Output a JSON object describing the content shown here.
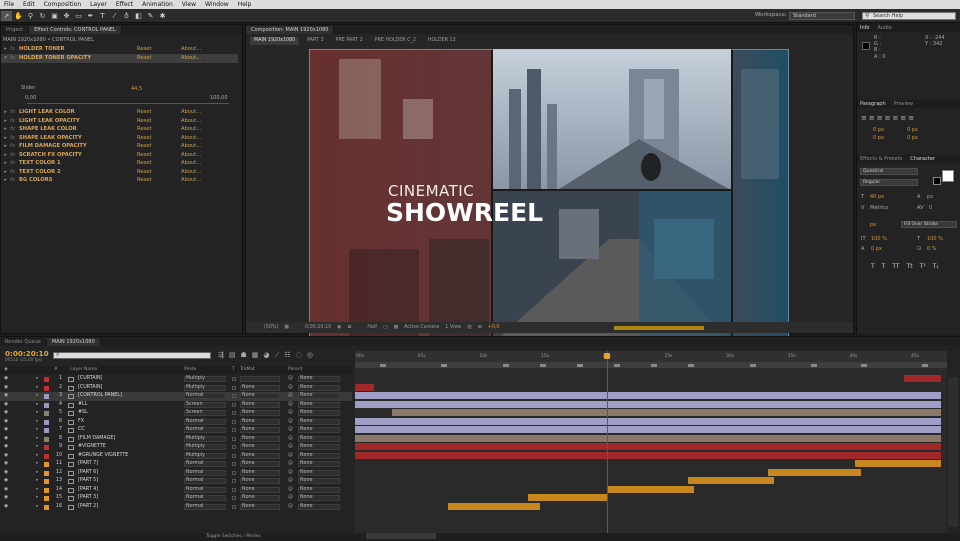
{
  "menubar": {
    "items": [
      "File",
      "Edit",
      "Composition",
      "Layer",
      "Effect",
      "Animation",
      "View",
      "Window",
      "Help"
    ]
  },
  "toolbar": {
    "workspace_label": "Workspace:",
    "workspace_value": "Standard",
    "search_placeholder": "Search Help"
  },
  "left_panel": {
    "tabs": [
      "Project",
      "Effect Controls: CONTROL PANEL"
    ],
    "header": "MAIN 1920x1080 • CONTROL PANEL",
    "reset_label": "Reset",
    "about_label": "About...",
    "effects": [
      {
        "name": "HOLDER TONER",
        "expanded": false,
        "selected": false
      },
      {
        "name": "HOLDER TONER OPACITY",
        "expanded": true,
        "selected": true
      },
      {
        "name": "LIGHT LEAK COLOR",
        "expanded": false,
        "selected": false
      },
      {
        "name": "LIGHT LEAK OPACITY",
        "expanded": false,
        "selected": false
      },
      {
        "name": "SHAPE LEAK COLOR",
        "expanded": false,
        "selected": false
      },
      {
        "name": "SHAPE LEAK OPACITY",
        "expanded": false,
        "selected": false
      },
      {
        "name": "FILM DAMAGE OPACITY",
        "expanded": false,
        "selected": false
      },
      {
        "name": "SCRATCH FX OPACITY",
        "expanded": false,
        "selected": false
      },
      {
        "name": "TEXT COLOR 1",
        "expanded": false,
        "selected": false
      },
      {
        "name": "TEXT COLOR 2",
        "expanded": false,
        "selected": false
      },
      {
        "name": "BG COLORS",
        "expanded": false,
        "selected": false
      }
    ],
    "slider": {
      "label": "Slider",
      "value": "44,5",
      "min": "0,00",
      "max": "100,00"
    }
  },
  "comp_panel": {
    "tabs": [
      "Composition: MAIN 1920x1080"
    ],
    "subtabs": [
      "MAIN 1920x1080",
      "PART 3",
      "PRE PART 2",
      "PRE HOLDER C_2",
      "HOLDER 13"
    ],
    "title_line1": "CINEMATIC",
    "title_line2": "SHOWREEL",
    "footer": {
      "zoom": "(50%)",
      "timecode": "0:00:20:10",
      "resolution": "Half",
      "camera": "Active Camera",
      "views": "1 View",
      "offset": "+0,0"
    }
  },
  "right_panel": {
    "info": {
      "tabs": [
        "Info",
        "Audio"
      ],
      "r": "R :",
      "g": "G :",
      "b": "B :",
      "a": "A : 0",
      "x": "X : -244",
      "y": "Y : 342"
    },
    "paragraph": {
      "tabs": [
        "Paragraph",
        "Preview"
      ],
      "values": [
        "0 px",
        "0 px",
        "0 px",
        "0 px",
        "0 px"
      ]
    },
    "character": {
      "tabs": [
        "Effects & Presets",
        "Character"
      ],
      "font": "Questrial",
      "style": "Regular",
      "size": "40 px",
      "tracking": "0",
      "leading": "px",
      "vscale": "100 %",
      "hscale": "100 %",
      "baseline": "0 px",
      "tsume": "0 %",
      "stroke_width": "px",
      "metrics": "Metrics",
      "stroke_mode": "Fill Over Stroke",
      "style_buttons": [
        "T",
        "T",
        "TT",
        "Tt",
        "T¹",
        "T₁"
      ]
    }
  },
  "timeline": {
    "tabs": [
      "Render Queue",
      "MAIN 1920x1080"
    ],
    "timecode": "0:00:20:10",
    "timecode_sub": "00510 (25.00 fps)",
    "columns": {
      "label": "#",
      "name": "Layer Name",
      "mode": "Mode",
      "t": "T",
      "trkmat": "TrkMat",
      "parent": "Parent"
    },
    "ruler": [
      "00s",
      "05s",
      "10s",
      "15s",
      "20s",
      "25s",
      "30s",
      "35s",
      "40s",
      "45s"
    ],
    "footer": "Toggle Switches / Modes",
    "layers": [
      {
        "num": "1",
        "name": "[CURTAIN]",
        "mode": "Multiply",
        "trkmat": "",
        "parent": "None",
        "label": "#c03030",
        "selected": false
      },
      {
        "num": "2",
        "name": "[CURTAIN]",
        "mode": "Multiply",
        "trkmat": "None",
        "parent": "None",
        "label": "#c03030",
        "selected": false
      },
      {
        "num": "3",
        "name": "[CONTROL PANEL]",
        "mode": "Normal",
        "trkmat": "None",
        "parent": "None",
        "label": "#9a9ac0",
        "selected": true
      },
      {
        "num": "4",
        "name": "#LL",
        "mode": "Screen",
        "trkmat": "None",
        "parent": "None",
        "label": "#9a9ac0",
        "selected": false
      },
      {
        "num": "5",
        "name": "#SL",
        "mode": "Screen",
        "trkmat": "None",
        "parent": "None",
        "label": "#8e8070",
        "selected": false
      },
      {
        "num": "6",
        "name": "FX",
        "mode": "Normal",
        "trkmat": "None",
        "parent": "None",
        "label": "#9a9ac0",
        "selected": false
      },
      {
        "num": "7",
        "name": "CC",
        "mode": "Normal",
        "trkmat": "None",
        "parent": "None",
        "label": "#9a9ac0",
        "selected": false
      },
      {
        "num": "8",
        "name": "[FILM DAMAGE]",
        "mode": "Multiply",
        "trkmat": "None",
        "parent": "None",
        "label": "#8e8070",
        "selected": false
      },
      {
        "num": "9",
        "name": "#VIGNETTE",
        "mode": "Multiply",
        "trkmat": "None",
        "parent": "None",
        "label": "#c03030",
        "selected": false
      },
      {
        "num": "10",
        "name": "#GRUNGE VIGNETTE",
        "mode": "Multiply",
        "trkmat": "None",
        "parent": "None",
        "label": "#c03030",
        "selected": false
      },
      {
        "num": "11",
        "name": "[PART 7]",
        "mode": "Normal",
        "trkmat": "None",
        "parent": "None",
        "label": "#e0962a",
        "selected": false
      },
      {
        "num": "12",
        "name": "[PART 6]",
        "mode": "Normal",
        "trkmat": "None",
        "parent": "None",
        "label": "#e0962a",
        "selected": false
      },
      {
        "num": "13",
        "name": "[PART 5]",
        "mode": "Normal",
        "trkmat": "None",
        "parent": "None",
        "label": "#e0962a",
        "selected": false
      },
      {
        "num": "14",
        "name": "[PART 4]",
        "mode": "Normal",
        "trkmat": "None",
        "parent": "None",
        "label": "#e0962a",
        "selected": false
      },
      {
        "num": "15",
        "name": "[PART 3]",
        "mode": "Normal",
        "trkmat": "None",
        "parent": "None",
        "label": "#e0962a",
        "selected": false
      },
      {
        "num": "16",
        "name": "[PART 2]",
        "mode": "Normal",
        "trkmat": "None",
        "parent": "None",
        "label": "#e0962a",
        "selected": false
      }
    ]
  },
  "colors": {
    "accent": "#e4a82b",
    "cti": "#d22222",
    "curtain": "#a02828",
    "control": "#9e9ec6",
    "film": "#8a7868",
    "part": "#c8861e"
  }
}
